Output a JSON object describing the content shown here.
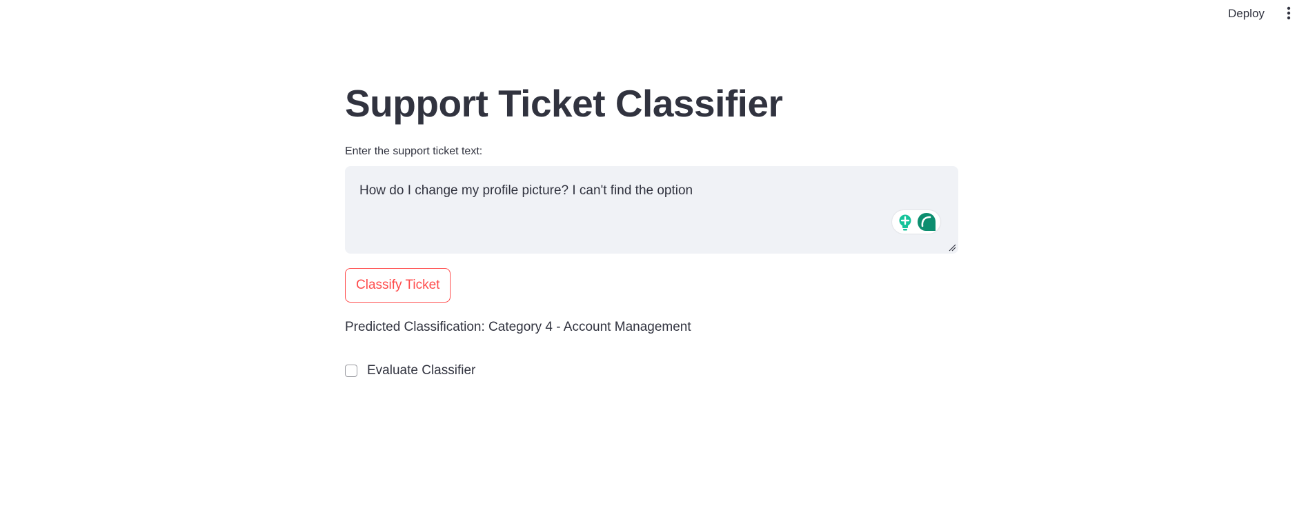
{
  "header": {
    "deploy_label": "Deploy",
    "menu_icon": "vertical-ellipsis-icon"
  },
  "main": {
    "title": "Support Ticket Classifier",
    "ticket_input": {
      "label": "Enter the support ticket text:",
      "value": "How do I change my profile picture? I can't find the option"
    },
    "classify_button_label": "Classify Ticket",
    "prediction_text": "Predicted Classification: Category 4 - Account Management",
    "evaluate_checkbox": {
      "label": "Evaluate Classifier",
      "checked": false
    }
  },
  "colors": {
    "text": "#31333f",
    "accent": "#ff4b4b",
    "input_bg": "#f0f2f6",
    "grammar_teal": "#15c39a",
    "grammar_dark": "#0d8e6f"
  }
}
